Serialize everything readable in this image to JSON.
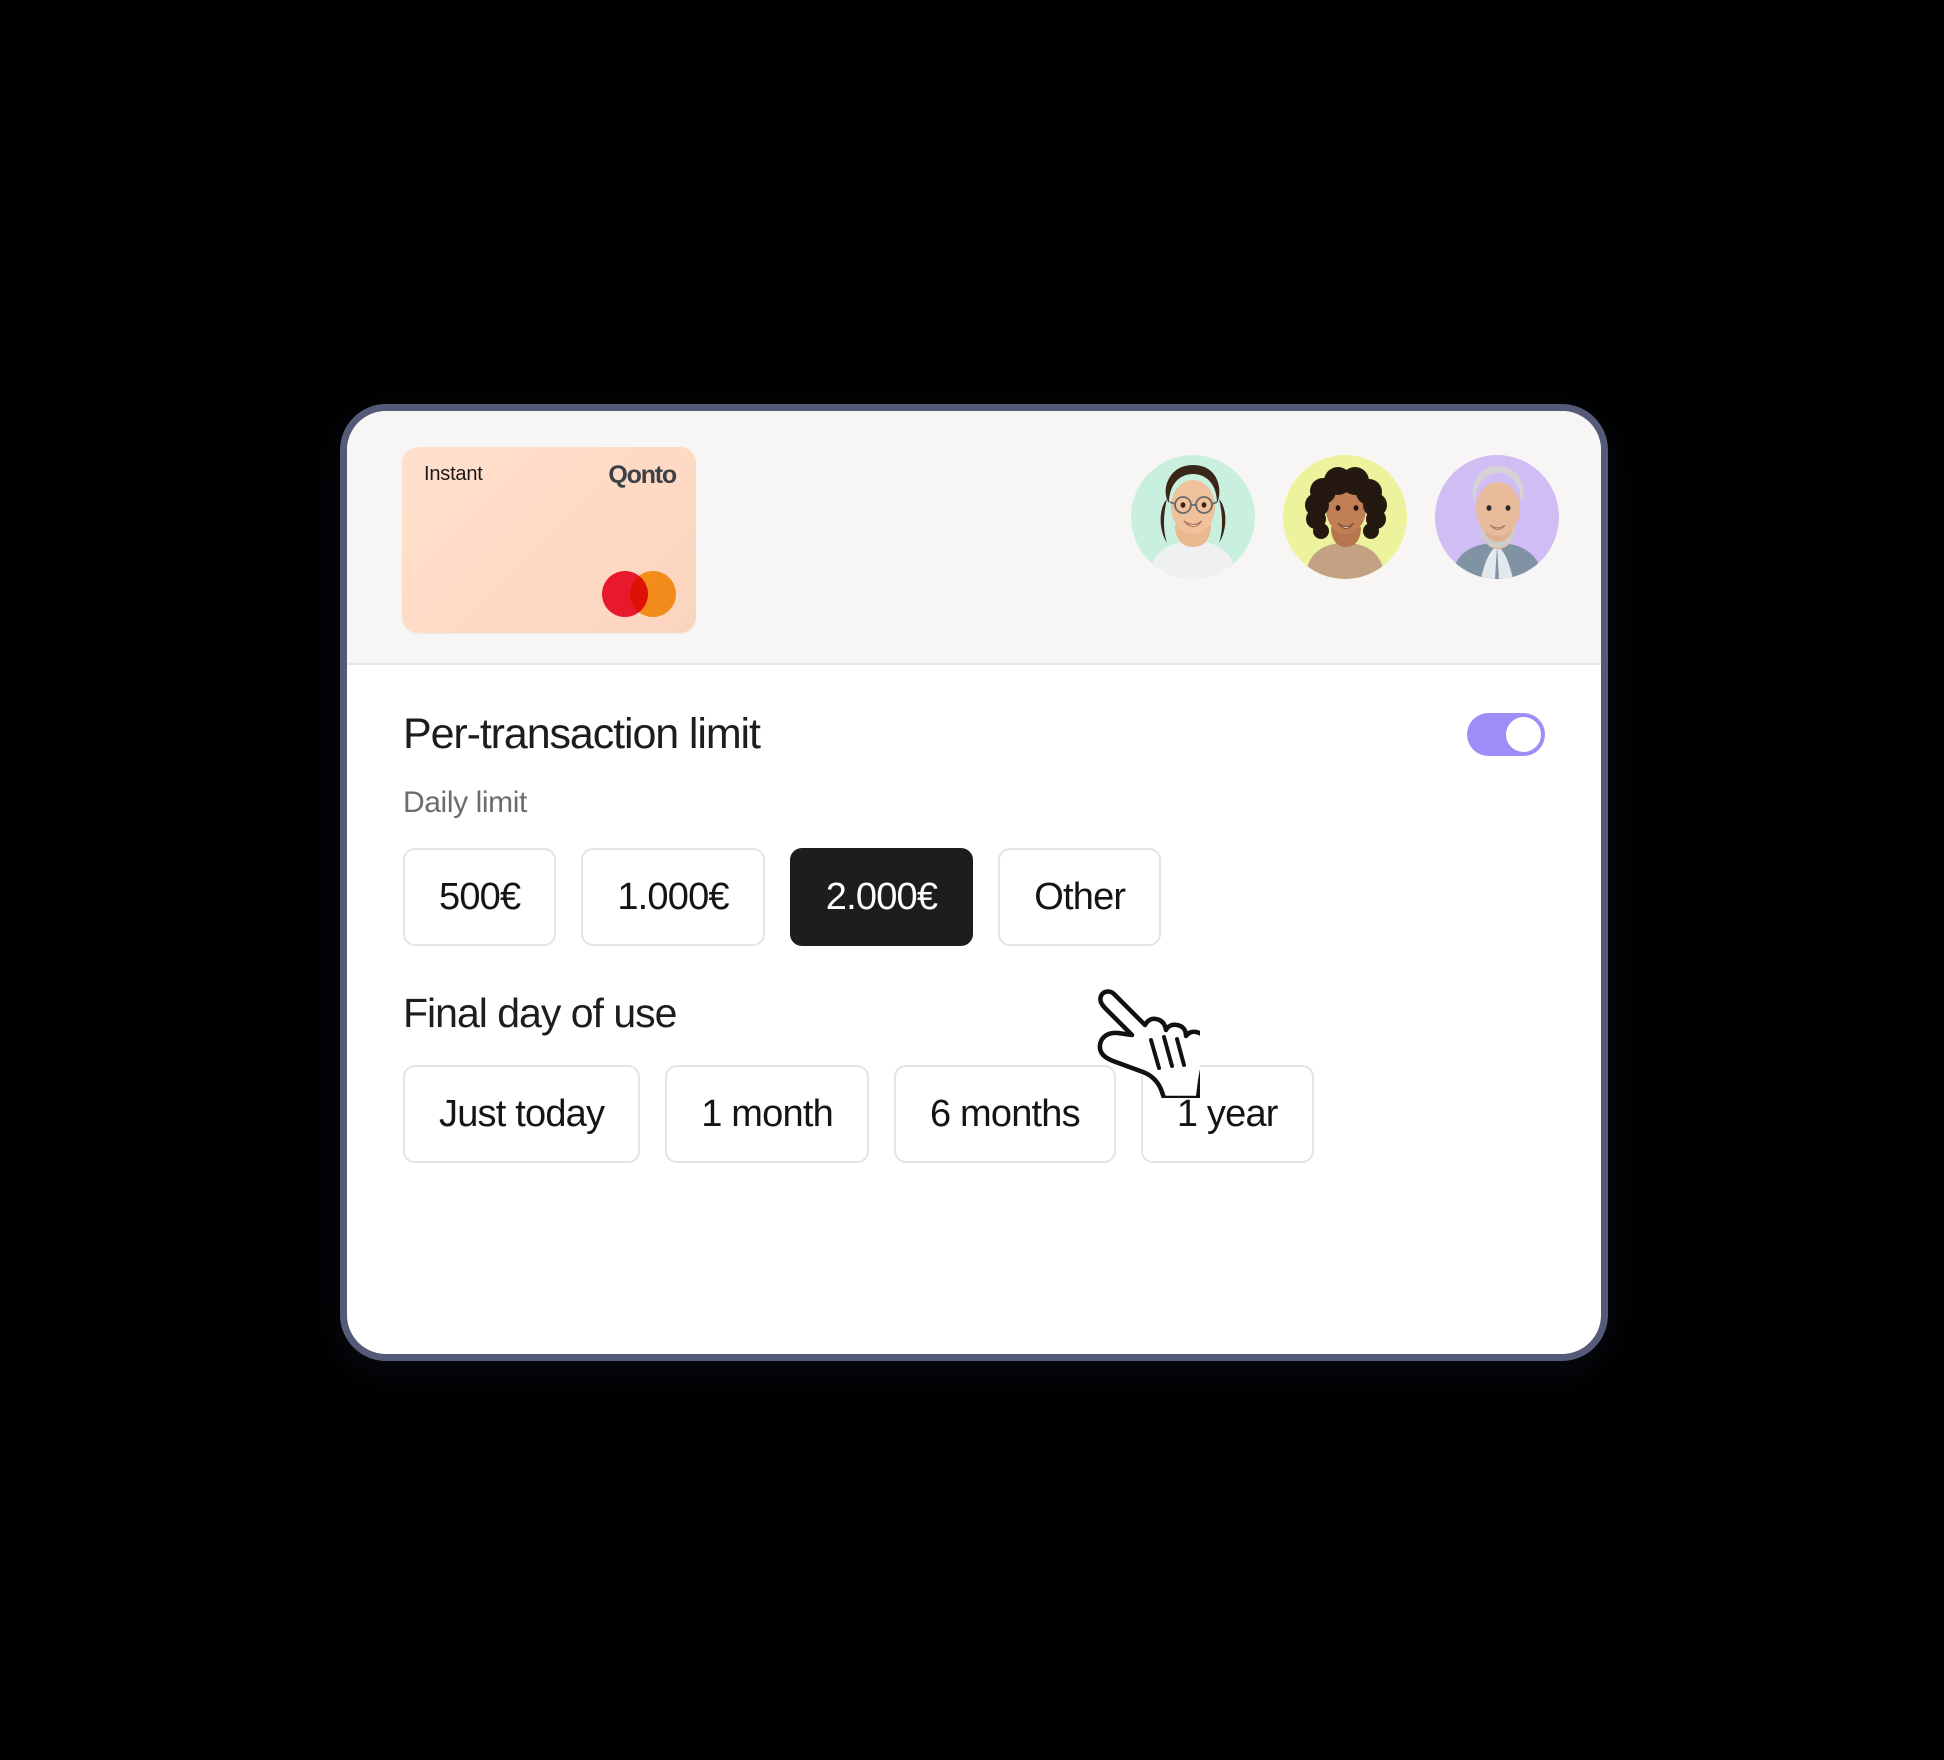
{
  "window": {
    "border_color": "#555a78",
    "header_bg": "#f7f6f4",
    "body_bg": "#ffffff"
  },
  "header": {
    "card": {
      "label": "Instant",
      "brand": "Qonto",
      "network_icon": "mastercard-icon",
      "gradient_from": "#ffe0cd",
      "gradient_to": "#fad4bf",
      "mastercard_red": "#e8192c",
      "mastercard_amber": "#f5a623"
    },
    "avatars": [
      {
        "name": "avatar-person-1",
        "bg": "#c9f0df",
        "skin": "#e9b88f",
        "hair": "#3a2519",
        "clothes": "#eef0f2"
      },
      {
        "name": "avatar-person-2",
        "bg": "#edf29c",
        "skin": "#b8764e",
        "hair": "#241811",
        "clothes": "#c3a183"
      },
      {
        "name": "avatar-person-3",
        "bg": "#cfbdf3",
        "skin": "#e0b092",
        "hair": "#d6d4d2",
        "clothes": "#7f93a5"
      }
    ]
  },
  "main": {
    "section_title": "Per-transaction limit",
    "toggle": {
      "state": "on",
      "accent_color": "#9e8cf7"
    },
    "daily_limit": {
      "label": "Daily limit",
      "options": [
        {
          "label": "500€",
          "selected": false
        },
        {
          "label": "1.000€",
          "selected": false
        },
        {
          "label": "2.000€",
          "selected": true
        },
        {
          "label": "Other",
          "selected": false
        }
      ]
    },
    "final_day": {
      "label": "Final day of use",
      "options": [
        {
          "label": "Just today",
          "selected": false
        },
        {
          "label": "1 month",
          "selected": false
        },
        {
          "label": "6 months",
          "selected": false
        },
        {
          "label": "1 year",
          "selected": false
        }
      ]
    }
  },
  "cursor": {
    "icon": "pointing-hand-cursor-icon"
  }
}
